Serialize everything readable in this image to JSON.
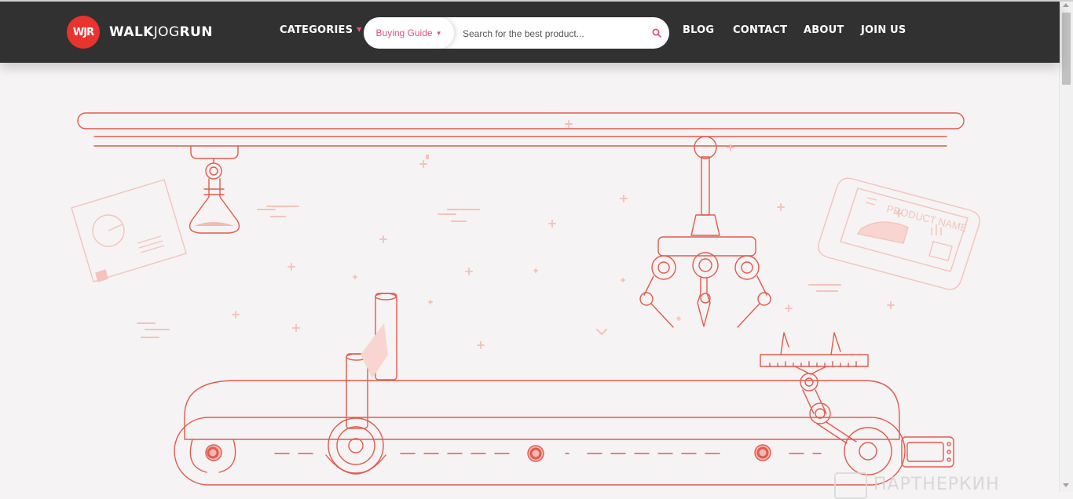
{
  "header": {
    "logo_badge": "WJR",
    "logo_brand_bold": "WALK",
    "logo_brand_light": "JOG",
    "logo_brand_end": "RUN",
    "nav": {
      "categories": "CATEGORIES",
      "blog": "BLOG",
      "contact": "CONTACT",
      "about": "ABOUT",
      "join": "JOIN US"
    },
    "search": {
      "category": "Buying Guide",
      "placeholder": "Search for the best product..."
    }
  },
  "hero": {
    "label_card": "PRODUCT NAME"
  },
  "watermark": "ПАРТНЕРКИН",
  "colors": {
    "header_bg": "#313131",
    "accent": "#e8332f",
    "pink": "#e5507a",
    "line": "#e35a4e",
    "faded": "#f2b8b2"
  }
}
